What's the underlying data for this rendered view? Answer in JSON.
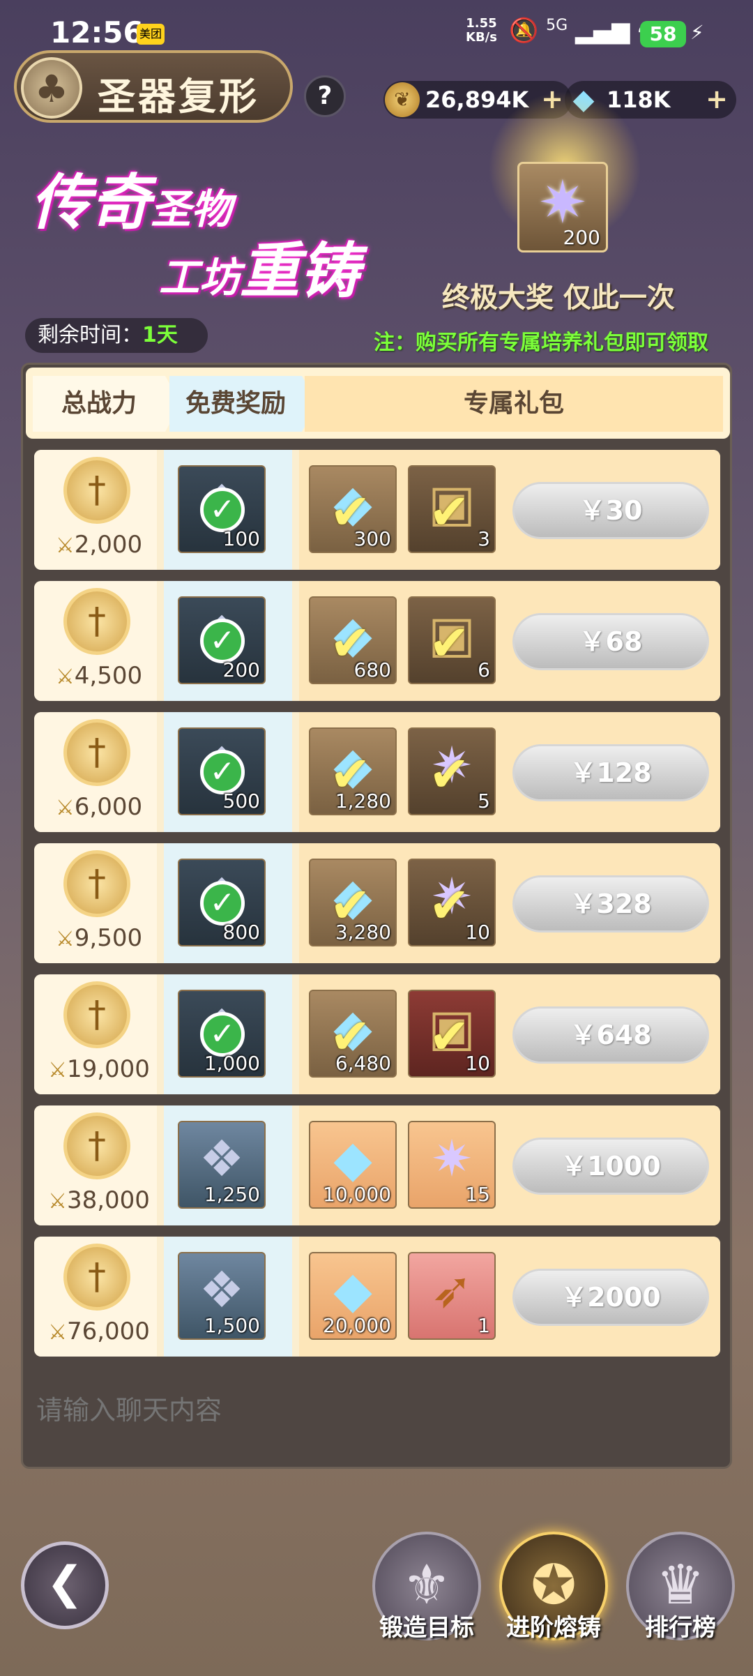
{
  "status": {
    "time": "12:56",
    "app_badge": "美团",
    "speed_value": "1.55",
    "speed_unit": "KB/s",
    "network": "5G",
    "battery": "58"
  },
  "header": {
    "title": "圣器复形",
    "help_label": "?",
    "gold_value": "26,894K",
    "gem_value": "118K",
    "plus": "+"
  },
  "banner": {
    "line1_big": "传奇",
    "line1_small": "圣物",
    "line2_small": "工坊",
    "line2_big": "重铸"
  },
  "grand_prize": {
    "count": "200",
    "title": "终极大奖 仅此一次",
    "note": "注：购买所有专属培养礼包即可领取"
  },
  "remaining": {
    "label": "剩余时间：",
    "value": "1天"
  },
  "tabs": {
    "power": "总战力",
    "free": "免费奖励",
    "pack": "专属礼包"
  },
  "rows": [
    {
      "power": "2,000",
      "free": "100",
      "gem": "300",
      "bonus": "3",
      "price": "￥30"
    },
    {
      "power": "4,500",
      "free": "200",
      "gem": "680",
      "bonus": "6",
      "price": "￥68"
    },
    {
      "power": "6,000",
      "free": "500",
      "gem": "1,280",
      "bonus": "5",
      "price": "￥128"
    },
    {
      "power": "9,500",
      "free": "800",
      "gem": "3,280",
      "bonus": "10",
      "price": "￥328"
    },
    {
      "power": "19,000",
      "free": "1,000",
      "gem": "6,480",
      "bonus": "10",
      "price": "￥648"
    },
    {
      "power": "38,000",
      "free": "1,250",
      "gem": "10,000",
      "bonus": "15",
      "price": "￥1000"
    },
    {
      "power": "76,000",
      "free": "1,500",
      "gem": "20,000",
      "bonus": "1",
      "price": "￥2000"
    }
  ],
  "chat": {
    "placeholder": "请输入聊天内容"
  },
  "nav": {
    "forge_target": "锻造目标",
    "advanced_forge": "进阶熔铸",
    "ranking": "排行榜"
  },
  "colors": {
    "accent_green": "#7cff3a",
    "banner_pink": "#ff3ad7",
    "price_gray": "#bcbcbc"
  }
}
